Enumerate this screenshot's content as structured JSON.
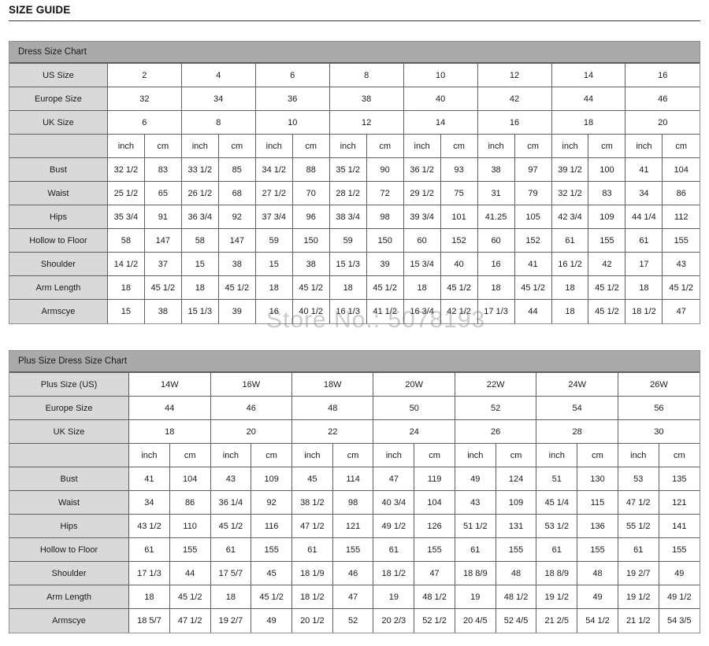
{
  "page": {
    "title": "SIZE GUIDE",
    "watermark": "Store No.: 5078193"
  },
  "colors": {
    "caption_bg": "#aaaaaa",
    "rowhead_bg": "#d9d9d9",
    "border": "#5e5e5e",
    "text": "#1a1a1a"
  },
  "charts": [
    {
      "caption": "Dress Size Chart",
      "size_rows": [
        {
          "label": "US Size",
          "values": [
            "2",
            "4",
            "6",
            "8",
            "10",
            "12",
            "14",
            "16"
          ]
        },
        {
          "label": "Europe Size",
          "values": [
            "32",
            "34",
            "36",
            "38",
            "40",
            "42",
            "44",
            "46"
          ]
        },
        {
          "label": "UK Size",
          "values": [
            "6",
            "8",
            "10",
            "12",
            "14",
            "16",
            "18",
            "20"
          ]
        }
      ],
      "unit_row": {
        "label": "",
        "units": [
          "inch",
          "cm",
          "inch",
          "cm",
          "inch",
          "cm",
          "inch",
          "cm",
          "inch",
          "cm",
          "inch",
          "cm",
          "inch",
          "cm",
          "inch",
          "cm"
        ]
      },
      "measure_rows": [
        {
          "label": "Bust",
          "values": [
            "32 1/2",
            "83",
            "33 1/2",
            "85",
            "34 1/2",
            "88",
            "35 1/2",
            "90",
            "36 1/2",
            "93",
            "38",
            "97",
            "39 1/2",
            "100",
            "41",
            "104"
          ]
        },
        {
          "label": "Waist",
          "values": [
            "25 1/2",
            "65",
            "26 1/2",
            "68",
            "27 1/2",
            "70",
            "28 1/2",
            "72",
            "29 1/2",
            "75",
            "31",
            "79",
            "32 1/2",
            "83",
            "34",
            "86"
          ]
        },
        {
          "label": "Hips",
          "values": [
            "35 3/4",
            "91",
            "36 3/4",
            "92",
            "37 3/4",
            "96",
            "38 3/4",
            "98",
            "39 3/4",
            "101",
            "41.25",
            "105",
            "42 3/4",
            "109",
            "44 1/4",
            "112"
          ]
        },
        {
          "label": "Hollow to Floor",
          "values": [
            "58",
            "147",
            "58",
            "147",
            "59",
            "150",
            "59",
            "150",
            "60",
            "152",
            "60",
            "152",
            "61",
            "155",
            "61",
            "155"
          ]
        },
        {
          "label": "Shoulder",
          "values": [
            "14 1/2",
            "37",
            "15",
            "38",
            "15",
            "38",
            "15 1/3",
            "39",
            "15 3/4",
            "40",
            "16",
            "41",
            "16 1/2",
            "42",
            "17",
            "43"
          ]
        },
        {
          "label": "Arm Length",
          "values": [
            "18",
            "45 1/2",
            "18",
            "45 1/2",
            "18",
            "45 1/2",
            "18",
            "45 1/2",
            "18",
            "45 1/2",
            "18",
            "45 1/2",
            "18",
            "45 1/2",
            "18",
            "45 1/2"
          ]
        },
        {
          "label": "Armscye",
          "values": [
            "15",
            "38",
            "15 1/3",
            "39",
            "16",
            "40 1/2",
            "16 1/3",
            "41 1/2",
            "16 3/4",
            "42 1/2",
            "17 1/3",
            "44",
            "18",
            "45 1/2",
            "18 1/2",
            "47"
          ]
        }
      ]
    },
    {
      "caption": "Plus Size Dress Size Chart",
      "size_rows": [
        {
          "label": "Plus Size (US)",
          "values": [
            "14W",
            "16W",
            "18W",
            "20W",
            "22W",
            "24W",
            "26W"
          ]
        },
        {
          "label": "Europe Size",
          "values": [
            "44",
            "46",
            "48",
            "50",
            "52",
            "54",
            "56"
          ]
        },
        {
          "label": "UK Size",
          "values": [
            "18",
            "20",
            "22",
            "24",
            "26",
            "28",
            "30"
          ]
        }
      ],
      "unit_row": {
        "label": "",
        "units": [
          "inch",
          "cm",
          "inch",
          "cm",
          "inch",
          "cm",
          "inch",
          "cm",
          "inch",
          "cm",
          "inch",
          "cm",
          "inch",
          "cm"
        ]
      },
      "measure_rows": [
        {
          "label": "Bust",
          "values": [
            "41",
            "104",
            "43",
            "109",
            "45",
            "114",
            "47",
            "119",
            "49",
            "124",
            "51",
            "130",
            "53",
            "135"
          ]
        },
        {
          "label": "Waist",
          "values": [
            "34",
            "86",
            "36 1/4",
            "92",
            "38 1/2",
            "98",
            "40 3/4",
            "104",
            "43",
            "109",
            "45 1/4",
            "115",
            "47 1/2",
            "121"
          ]
        },
        {
          "label": "Hips",
          "values": [
            "43 1/2",
            "110",
            "45 1/2",
            "116",
            "47 1/2",
            "121",
            "49 1/2",
            "126",
            "51 1/2",
            "131",
            "53 1/2",
            "136",
            "55 1/2",
            "141"
          ]
        },
        {
          "label": "Hollow to Floor",
          "values": [
            "61",
            "155",
            "61",
            "155",
            "61",
            "155",
            "61",
            "155",
            "61",
            "155",
            "61",
            "155",
            "61",
            "155"
          ]
        },
        {
          "label": "Shoulder",
          "values": [
            "17 1/3",
            "44",
            "17 5/7",
            "45",
            "18 1/9",
            "46",
            "18 1/2",
            "47",
            "18 8/9",
            "48",
            "18 8/9",
            "48",
            "19 2/7",
            "49"
          ]
        },
        {
          "label": "Arm Length",
          "values": [
            "18",
            "45 1/2",
            "18",
            "45 1/2",
            "18 1/2",
            "47",
            "19",
            "48 1/2",
            "19",
            "48 1/2",
            "19 1/2",
            "49",
            "19 1/2",
            "49 1/2"
          ]
        },
        {
          "label": "Armscye",
          "values": [
            "18 5/7",
            "47 1/2",
            "19 2/7",
            "49",
            "20 1/2",
            "52",
            "20 2/3",
            "52 1/2",
            "20 4/5",
            "52 4/5",
            "21 2/5",
            "54 1/2",
            "21 1/2",
            "54 3/5"
          ]
        }
      ]
    }
  ]
}
